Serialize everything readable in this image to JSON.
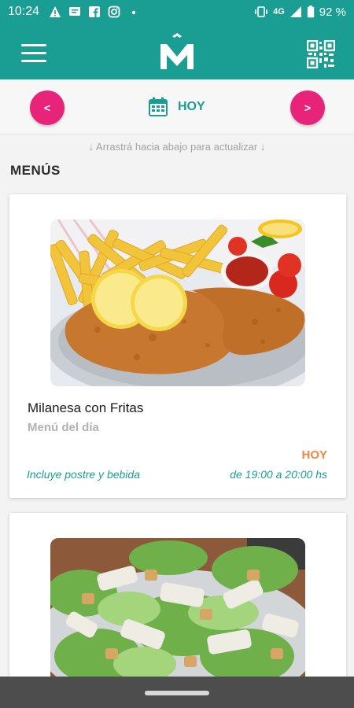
{
  "status_bar": {
    "time": "10:24",
    "network": "4G",
    "battery": "92 %",
    "icons": [
      "warning-icon",
      "message-icon",
      "facebook-icon",
      "instagram-icon",
      "dot-icon",
      "vibrate-icon",
      "signal-icon",
      "battery-icon"
    ]
  },
  "app_bar": {
    "menu_icon": "hamburger-menu-icon",
    "logo_icon": "m-logo-icon",
    "qr_icon": "qr-code-icon",
    "background": "#1a9e93"
  },
  "date_nav": {
    "prev_label": "<",
    "next_label": ">",
    "current_label": "HOY",
    "calendar_icon": "calendar-icon",
    "accent": "#e8237a"
  },
  "pull_hint": "↓ Arrastrá hacia abajo para actualizar ↓",
  "section_title": "MENÚS",
  "menus": [
    {
      "name": "Milanesa con Fritas",
      "subtitle": "Menú del día",
      "day": "HOY",
      "includes": "Incluye postre y bebida",
      "hours": "de 19:00 a 20:00 hs"
    },
    {
      "name": "",
      "subtitle": "",
      "day": "",
      "includes": "",
      "hours": ""
    }
  ],
  "colors": {
    "teal": "#1a9e93",
    "pink": "#e8237a",
    "orange": "#f0873e"
  }
}
